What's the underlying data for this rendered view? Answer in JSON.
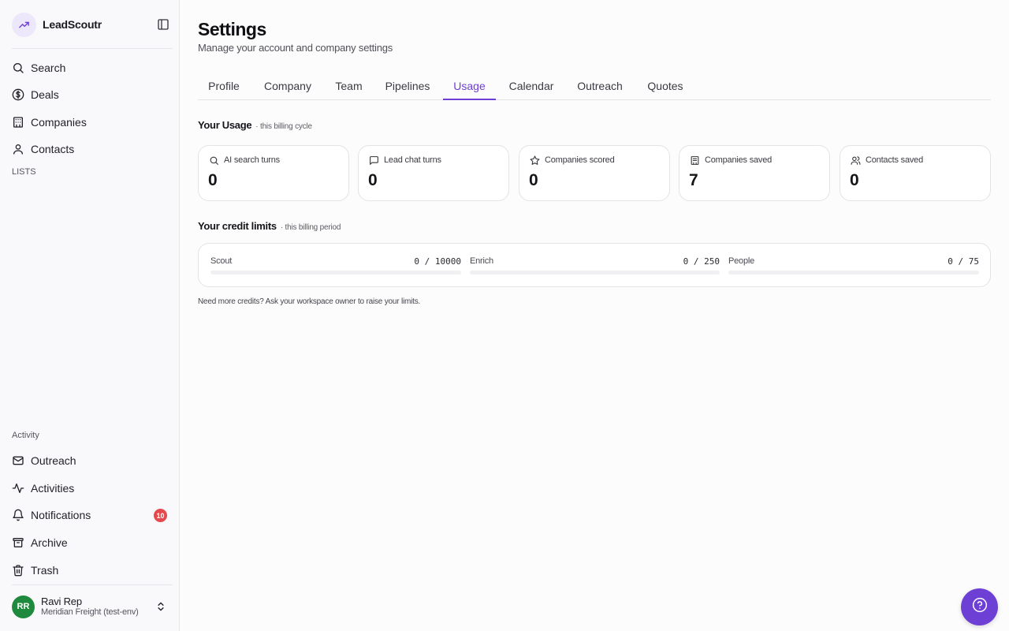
{
  "colors": {
    "accent": "#6e3fd4",
    "badge": "#e5484d",
    "avatar": "#1f8a3d"
  },
  "sidebar": {
    "brand": "LeadScoutr",
    "nav": [
      {
        "label": "Search",
        "icon": "search-icon"
      },
      {
        "label": "Deals",
        "icon": "dollar-circle-icon"
      },
      {
        "label": "Companies",
        "icon": "building-icon"
      },
      {
        "label": "Contacts",
        "icon": "user-icon"
      }
    ],
    "lists_label": "LISTS",
    "activity_label": "Activity",
    "activity": [
      {
        "label": "Outreach",
        "icon": "mail-icon"
      },
      {
        "label": "Activities",
        "icon": "activity-icon"
      },
      {
        "label": "Notifications",
        "icon": "bell-icon",
        "badge": "10"
      },
      {
        "label": "Archive",
        "icon": "archive-icon"
      },
      {
        "label": "Trash",
        "icon": "trash-icon"
      }
    ],
    "user": {
      "initials": "RR",
      "name": "Ravi Rep",
      "org": "Meridian Freight (test-env)"
    }
  },
  "header": {
    "title": "Settings",
    "subtitle": "Manage your account and company settings"
  },
  "tabs": [
    "Profile",
    "Company",
    "Team",
    "Pipelines",
    "Usage",
    "Calendar",
    "Outreach",
    "Quotes"
  ],
  "active_tab": "Usage",
  "usage": {
    "title": "Your Usage",
    "note": "· this billing cycle",
    "stats": [
      {
        "label": "AI search turns",
        "value": "0",
        "icon": "search-icon"
      },
      {
        "label": "Lead chat turns",
        "value": "0",
        "icon": "chat-icon"
      },
      {
        "label": "Companies scored",
        "value": "0",
        "icon": "star-icon"
      },
      {
        "label": "Companies saved",
        "value": "7",
        "icon": "building-icon"
      },
      {
        "label": "Contacts saved",
        "value": "0",
        "icon": "users-icon"
      }
    ]
  },
  "credits": {
    "title": "Your credit limits",
    "note": "· this billing period",
    "items": [
      {
        "name": "Scout",
        "value": "0 / 10000",
        "used_fraction": 0
      },
      {
        "name": "Enrich",
        "value": "0 / 250",
        "used_fraction": 0
      },
      {
        "name": "People",
        "value": "0 / 75",
        "used_fraction": 0
      }
    ],
    "footnote": "Need more credits? Ask your workspace owner to raise your limits."
  },
  "help": {
    "icon": "help-circle-icon"
  }
}
